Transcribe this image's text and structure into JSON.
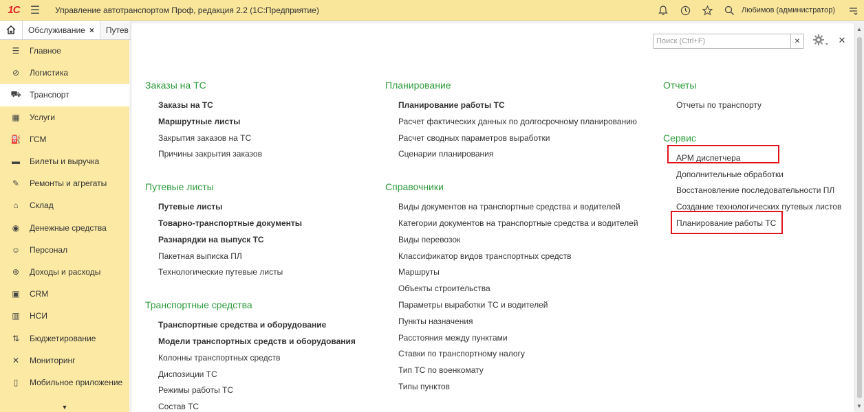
{
  "titlebar": {
    "logo": "1С",
    "title": "Управление автотранспортом Проф, редакция 2.2  (1С:Предприятие)",
    "user": "Любимов (администратор)"
  },
  "tabs": {
    "items": [
      {
        "label": "Обслуживание"
      },
      {
        "label": "Путев"
      }
    ],
    "close_glyph": "×"
  },
  "sidebar": {
    "items": [
      {
        "label": "Главное",
        "icon": "menu-lines-icon"
      },
      {
        "label": "Логистика",
        "icon": "compass-icon"
      },
      {
        "label": "Транспорт",
        "icon": "bus-icon"
      },
      {
        "label": "Услуги",
        "icon": "calculator-icon"
      },
      {
        "label": "ГСМ",
        "icon": "fuel-icon"
      },
      {
        "label": "Билеты и выручка",
        "icon": "ticket-icon"
      },
      {
        "label": "Ремонты и агрегаты",
        "icon": "wrench-icon"
      },
      {
        "label": "Склад",
        "icon": "warehouse-icon"
      },
      {
        "label": "Денежные средства",
        "icon": "money-icon"
      },
      {
        "label": "Персонал",
        "icon": "person-icon"
      },
      {
        "label": "Доходы и расходы",
        "icon": "coins-icon"
      },
      {
        "label": "CRM",
        "icon": "crm-icon"
      },
      {
        "label": "НСИ",
        "icon": "books-icon"
      },
      {
        "label": "Бюджетирование",
        "icon": "budget-icon"
      },
      {
        "label": "Мониторинг",
        "icon": "satellite-icon"
      },
      {
        "label": "Мобильное приложение",
        "icon": "phone-icon"
      }
    ],
    "active_index": 2
  },
  "search": {
    "placeholder": "Поиск (Ctrl+F)",
    "value": ""
  },
  "columns": [
    {
      "groups": [
        {
          "title": "Заказы на ТС",
          "links": [
            {
              "label": "Заказы на ТС",
              "bold": true
            },
            {
              "label": "Маршрутные листы",
              "bold": true
            },
            {
              "label": "Закрытия заказов на ТС",
              "bold": false
            },
            {
              "label": "Причины закрытия заказов",
              "bold": false
            }
          ]
        },
        {
          "title": "Путевые листы",
          "links": [
            {
              "label": "Путевые листы",
              "bold": true
            },
            {
              "label": "Товарно-транспортные документы",
              "bold": true
            },
            {
              "label": "Разнарядки на выпуск ТС",
              "bold": true
            },
            {
              "label": "Пакетная выписка ПЛ",
              "bold": false
            },
            {
              "label": "Технологические путевые листы",
              "bold": false
            }
          ]
        },
        {
          "title": "Транспортные средства",
          "links": [
            {
              "label": "Транспортные средства и оборудование",
              "bold": true
            },
            {
              "label": "Модели транспортных средств и оборудования",
              "bold": true
            },
            {
              "label": "Колонны транспортных средств",
              "bold": false
            },
            {
              "label": "Диспозиции ТС",
              "bold": false
            },
            {
              "label": "Режимы работы ТС",
              "bold": false
            },
            {
              "label": "Состав ТС",
              "bold": false
            }
          ]
        }
      ]
    },
    {
      "groups": [
        {
          "title": "Планирование",
          "links": [
            {
              "label": "Планирование работы ТС",
              "bold": true
            },
            {
              "label": "Расчет фактических данных по долгосрочному планированию",
              "bold": false
            },
            {
              "label": "Расчет сводных параметров выработки",
              "bold": false
            },
            {
              "label": "Сценарии планирования",
              "bold": false
            }
          ]
        },
        {
          "title": "Справочники",
          "links": [
            {
              "label": "Виды документов на транспортные средства и водителей",
              "bold": false
            },
            {
              "label": "Категории документов на транспортные средства и водителей",
              "bold": false
            },
            {
              "label": "Виды перевозок",
              "bold": false
            },
            {
              "label": "Классификатор видов транспортных средств",
              "bold": false
            },
            {
              "label": "Маршруты",
              "bold": false
            },
            {
              "label": "Объекты строительства",
              "bold": false
            },
            {
              "label": "Параметры выработки ТС и водителей",
              "bold": false
            },
            {
              "label": "Пункты назначения",
              "bold": false
            },
            {
              "label": "Расстояния между пунктами",
              "bold": false
            },
            {
              "label": "Ставки по транспортному налогу",
              "bold": false
            },
            {
              "label": "Тип ТС по военкомату",
              "bold": false
            },
            {
              "label": "Типы пунктов",
              "bold": false
            }
          ]
        }
      ]
    },
    {
      "groups": [
        {
          "title": "Отчеты",
          "links": [
            {
              "label": "Отчеты по транспорту",
              "bold": false
            }
          ]
        },
        {
          "title": "Сервис",
          "links": [
            {
              "label": "АРМ диспетчера",
              "bold": false
            },
            {
              "label": "Дополнительные обработки",
              "bold": false
            },
            {
              "label": "Восстановление последовательности ПЛ",
              "bold": false
            },
            {
              "label": "Создание технологических путевых листов",
              "bold": false
            },
            {
              "label": "Планирование работы ТС",
              "bold": false
            }
          ]
        }
      ]
    }
  ],
  "highlight_color": "#e0141c",
  "group_title_color": "#2d9b3c"
}
